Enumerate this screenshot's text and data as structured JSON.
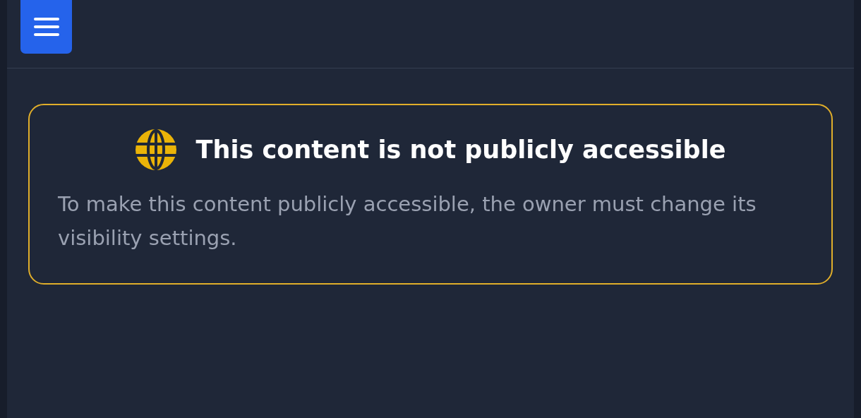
{
  "notice": {
    "title": "This content is not publicly accessible",
    "message": "To make this content publicly accessible, the owner must change its visibility settings."
  }
}
